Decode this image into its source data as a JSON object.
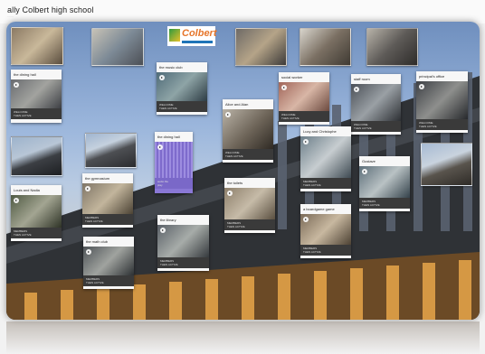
{
  "page": {
    "title": "ally Colbert high school",
    "subtitle": "·······"
  },
  "logo": {
    "text": "Colbert"
  },
  "photos": [
    {
      "name": "photo-classroom-1"
    },
    {
      "name": "photo-classroom-2"
    },
    {
      "name": "photo-classroom-3"
    },
    {
      "name": "photo-classroom-4"
    },
    {
      "name": "photo-classroom-5"
    },
    {
      "name": "photo-building-left"
    },
    {
      "name": "photo-building-mid"
    },
    {
      "name": "photo-building-right"
    }
  ],
  "cards": [
    {
      "title": "the dining hall",
      "foot": [
        "WELCOME",
        "THEN ACTIVE"
      ]
    },
    {
      "title": "the music club",
      "foot": [
        "WELCOME",
        "THEN ACTIVE"
      ]
    },
    {
      "title": "the dining hall",
      "foot": [
        "audio file",
        "play"
      ]
    },
    {
      "title": "Alice and Alan",
      "foot": [
        "WELCOME",
        "THEN ACTIVE"
      ]
    },
    {
      "title": "social worker",
      "foot": [
        "WELCOME",
        "THEN ACTIVE"
      ]
    },
    {
      "title": "staff room",
      "foot": [
        "WELCOME",
        "THEN ACTIVE"
      ]
    },
    {
      "title": "principal's office",
      "foot": [
        "WELCOME",
        "THEN ACTIVE"
      ]
    },
    {
      "title": "Louis and Nadia",
      "foot": [
        "MEMBERS",
        "THEN ACTIVE"
      ]
    },
    {
      "title": "the gymnasium",
      "foot": [
        "MEMBERS",
        "THEN ACTIVE"
      ]
    },
    {
      "title": "the toilets",
      "foot": [
        "MEMBERS",
        "THEN ACTIVE"
      ]
    },
    {
      "title": "Lucy and Christophe",
      "foot": [
        "MEMBERS",
        "THEN ACTIVE"
      ]
    },
    {
      "title": "Gustave",
      "foot": [
        "MEMBERS",
        "THEN ACTIVE"
      ]
    },
    {
      "title": "the library",
      "foot": [
        "MEMBERS",
        "THEN ACTIVE"
      ]
    },
    {
      "title": "a boardgame game",
      "foot": [
        "MEMBERS",
        "THEN ACTIVE"
      ]
    },
    {
      "title": "the math club",
      "foot": [
        "MEMBERS",
        "THEN ACTIVE"
      ]
    }
  ]
}
